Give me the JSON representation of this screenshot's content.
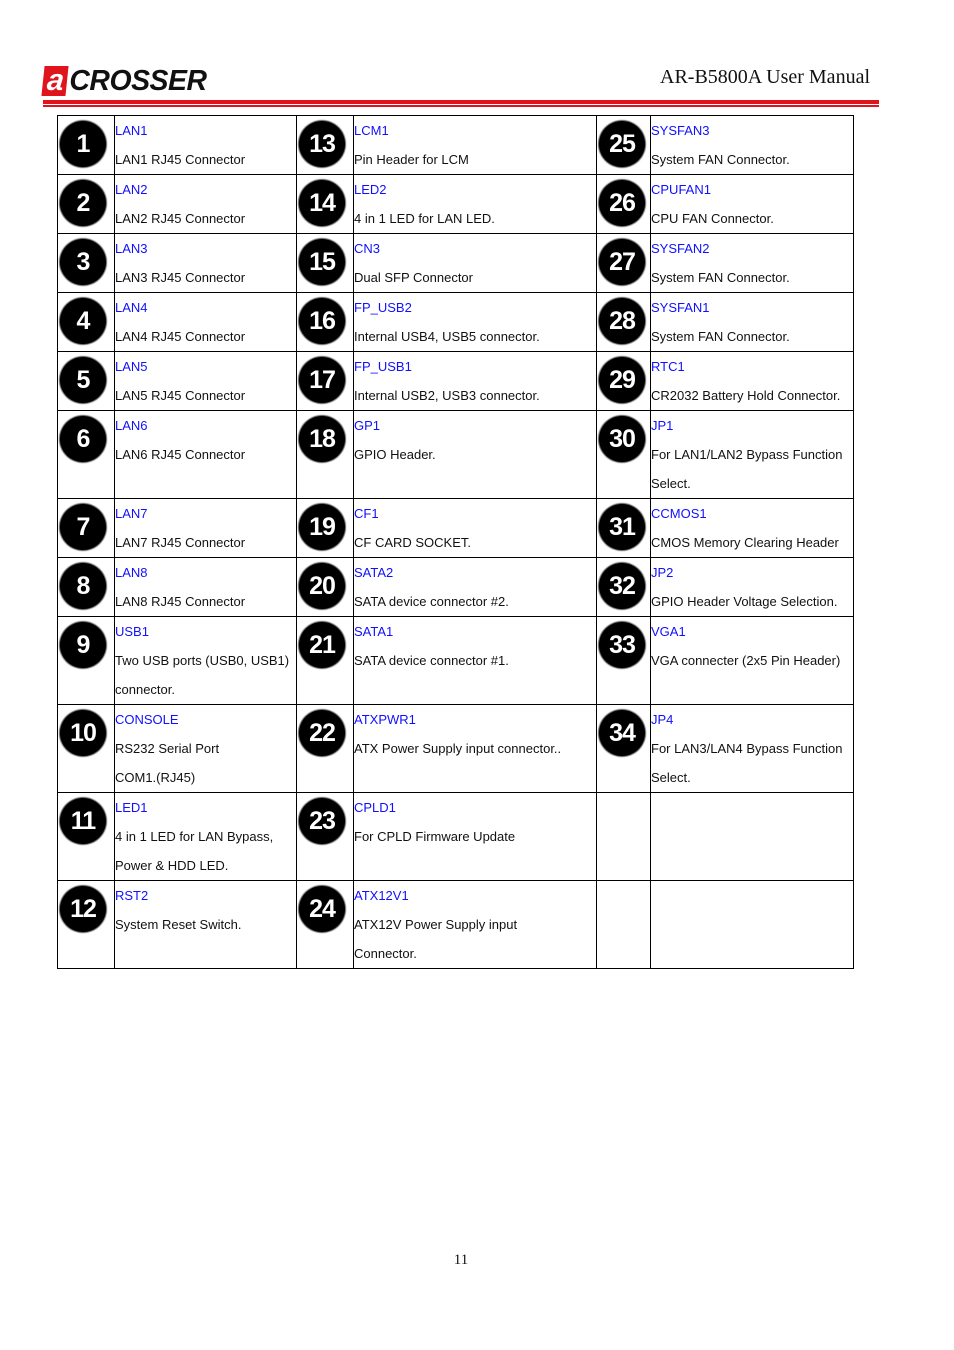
{
  "header": {
    "logo_letter": "a",
    "logo_text": "CROSSER",
    "document_title": "AR-B5800A User Manual",
    "brand_color": "#e0141c"
  },
  "table": {
    "label_color": "#1010ff",
    "rows": [
      [
        {
          "n": "1",
          "label": "LAN1",
          "text": [
            "LAN1 RJ45 Connector"
          ]
        },
        {
          "n": "13",
          "label": "LCM1",
          "text": [
            "Pin Header for LCM"
          ]
        },
        {
          "n": "25",
          "label": "SYSFAN3",
          "text": [
            "System FAN Connector."
          ]
        }
      ],
      [
        {
          "n": "2",
          "label": "LAN2",
          "text": [
            "LAN2 RJ45 Connector"
          ]
        },
        {
          "n": "14",
          "label": "LED2",
          "text": [
            "4 in 1 LED for LAN LED."
          ]
        },
        {
          "n": "26",
          "label": "CPUFAN1",
          "text": [
            "CPU FAN Connector."
          ]
        }
      ],
      [
        {
          "n": "3",
          "label": "LAN3",
          "text": [
            "LAN3 RJ45 Connector"
          ]
        },
        {
          "n": "15",
          "label": "CN3",
          "text": [
            "Dual SFP Connector"
          ]
        },
        {
          "n": "27",
          "label": "SYSFAN2",
          "text": [
            "System FAN Connector."
          ]
        }
      ],
      [
        {
          "n": "4",
          "label": "LAN4",
          "text": [
            "LAN4 RJ45 Connector"
          ]
        },
        {
          "n": "16",
          "label": "FP_USB2",
          "text": [
            "Internal USB4, USB5 connector."
          ]
        },
        {
          "n": "28",
          "label": "SYSFAN1",
          "text": [
            "System FAN Connector."
          ]
        }
      ],
      [
        {
          "n": "5",
          "label": "LAN5",
          "text": [
            "LAN5 RJ45 Connector"
          ]
        },
        {
          "n": "17",
          "label": "FP_USB1",
          "text": [
            "Internal USB2, USB3 connector."
          ]
        },
        {
          "n": "29",
          "label": "RTC1",
          "text": [
            "CR2032 Battery Hold Connector."
          ]
        }
      ],
      [
        {
          "n": "6",
          "label": "LAN6",
          "text": [
            "LAN6 RJ45 Connector"
          ]
        },
        {
          "n": "18",
          "label": "GP1",
          "text": [
            "GPIO Header."
          ]
        },
        {
          "n": "30",
          "label": "JP1",
          "text": [
            "For LAN1/LAN2 Bypass Function",
            "Select."
          ]
        }
      ],
      [
        {
          "n": "7",
          "label": "LAN7",
          "text": [
            "LAN7 RJ45 Connector"
          ]
        },
        {
          "n": "19",
          "label": "CF1",
          "text": [
            "CF CARD SOCKET."
          ]
        },
        {
          "n": "31",
          "label": "CCMOS1",
          "text": [
            "CMOS Memory Clearing Header"
          ]
        }
      ],
      [
        {
          "n": "8",
          "label": "LAN8",
          "text": [
            "LAN8 RJ45 Connector"
          ]
        },
        {
          "n": "20",
          "label": "SATA2",
          "text": [
            "SATA device connector #2."
          ]
        },
        {
          "n": "32",
          "label": "JP2",
          "text": [
            "GPIO Header Voltage Selection."
          ]
        }
      ],
      [
        {
          "n": "9",
          "label": "USB1",
          "text": [
            "Two USB ports (USB0, USB1)",
            "connector."
          ]
        },
        {
          "n": "21",
          "label": "SATA1",
          "text": [
            "SATA device connector #1."
          ]
        },
        {
          "n": "33",
          "label": "VGA1",
          "text": [
            "VGA connecter (2x5 Pin Header)"
          ]
        }
      ],
      [
        {
          "n": "10",
          "label": "CONSOLE",
          "text": [
            "RS232 Serial Port",
            "COM1.(RJ45)"
          ]
        },
        {
          "n": "22",
          "label": "ATXPWR1",
          "text": [
            "ATX Power Supply input connector.."
          ]
        },
        {
          "n": "34",
          "label": "JP4",
          "text": [
            "For LAN3/LAN4 Bypass Function",
            "Select."
          ]
        }
      ],
      [
        {
          "n": "11",
          "label": "LED1",
          "text": [
            "4 in 1 LED for LAN Bypass,",
            "Power & HDD LED."
          ]
        },
        {
          "n": "23",
          "label": "CPLD1",
          "text": [
            "For CPLD Firmware Update"
          ]
        },
        {
          "n": "",
          "label": "",
          "text": []
        }
      ],
      [
        {
          "n": "12",
          "label": "RST2",
          "text": [
            "System Reset Switch."
          ]
        },
        {
          "n": "24",
          "label": "ATX12V1",
          "text": [
            "ATX12V Power Supply input",
            "Connector."
          ]
        },
        {
          "n": "",
          "label": "",
          "text": []
        }
      ]
    ]
  },
  "footer": {
    "page_number": "11"
  }
}
